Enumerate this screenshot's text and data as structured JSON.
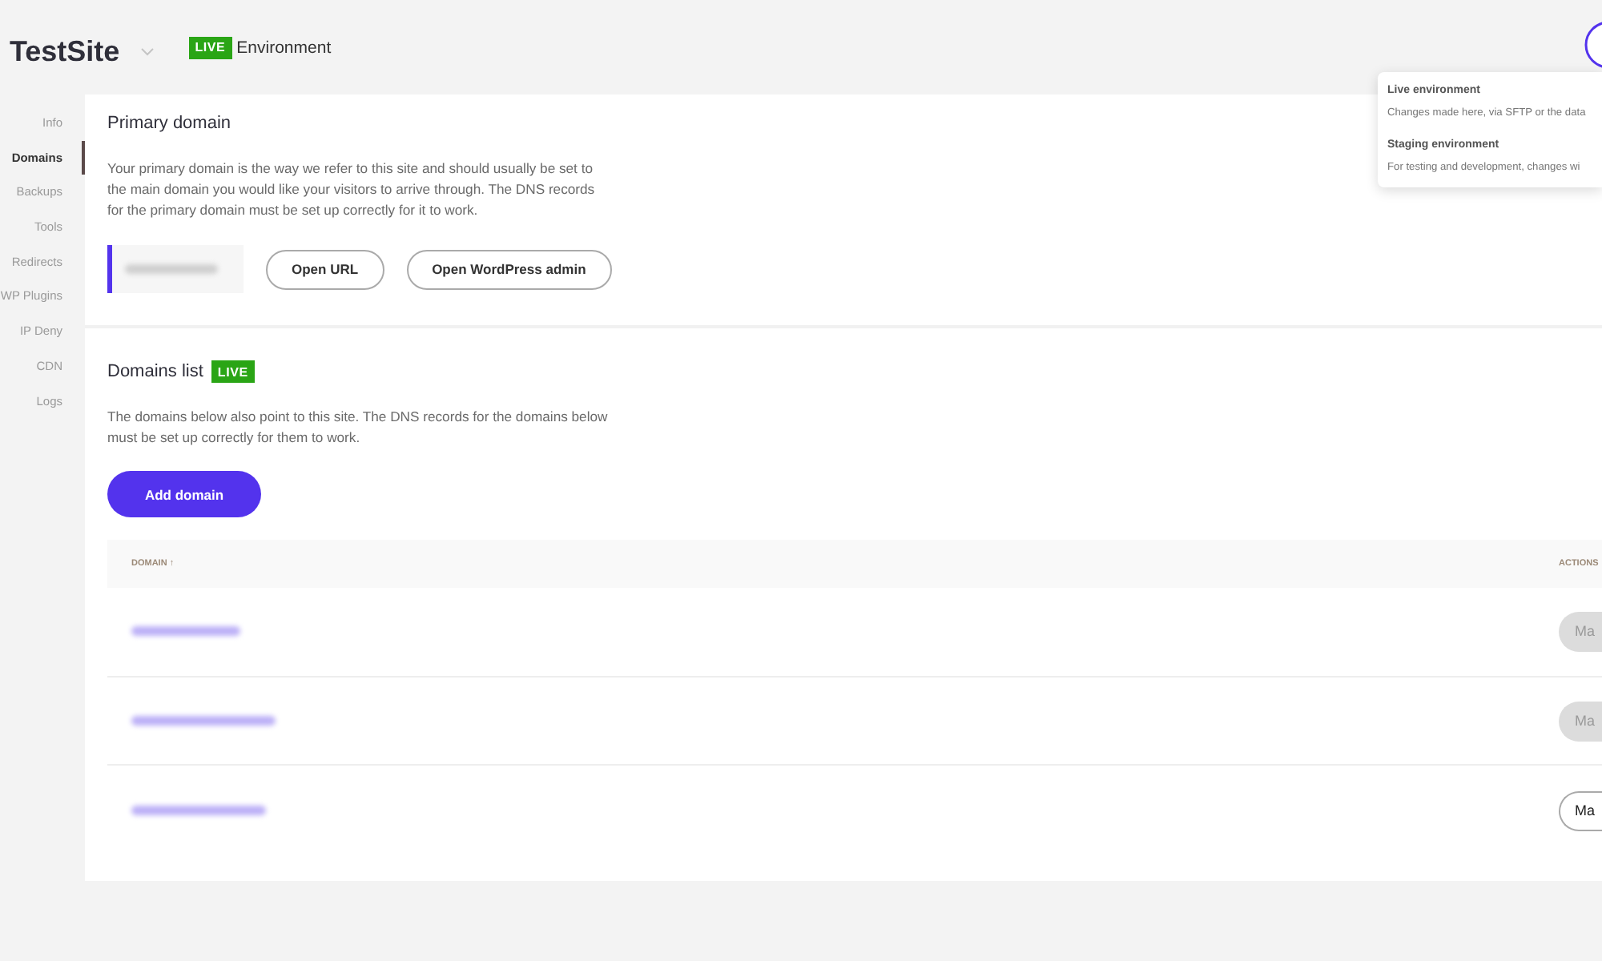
{
  "header": {
    "site_name": "TestSite",
    "environment_badge": "LIVE",
    "environment_label": "Environment"
  },
  "environment_popover": {
    "items": [
      {
        "title": "Live environment",
        "description": "Changes made here, via SFTP or the data"
      },
      {
        "title": "Staging environment",
        "description": "For testing and development, changes wi"
      }
    ]
  },
  "sidebar": {
    "items": [
      {
        "label": "Info",
        "selected": false
      },
      {
        "label": "Domains",
        "selected": true
      },
      {
        "label": "Backups",
        "selected": false
      },
      {
        "label": "Tools",
        "selected": false
      },
      {
        "label": "Redirects",
        "selected": false
      },
      {
        "label": "WP Plugins",
        "selected": false
      },
      {
        "label": "IP Deny",
        "selected": false
      },
      {
        "label": "CDN",
        "selected": false
      },
      {
        "label": "Logs",
        "selected": false
      }
    ]
  },
  "primary_domain": {
    "title": "Primary domain",
    "description": "Your primary domain is the way we refer to this site and should usually be set to the main domain you would like your visitors to arrive through. The DNS records for the primary domain must be set up correctly for it to work.",
    "buttons": [
      "Open URL",
      "Open WordPress admin"
    ]
  },
  "domains_list": {
    "title": "Domains list",
    "badge": "LIVE",
    "description": "The domains below also point to this site. The DNS records for the domains below must be set up correctly for them to work.",
    "add_button": "Add domain",
    "table": {
      "columns": [
        "DOMAIN ↑",
        "ACTIONS"
      ],
      "rows": [
        {
          "action": "Ma",
          "disabled": true
        },
        {
          "action": "Ma",
          "disabled": true
        },
        {
          "action": "Ma",
          "disabled": false
        }
      ]
    }
  }
}
